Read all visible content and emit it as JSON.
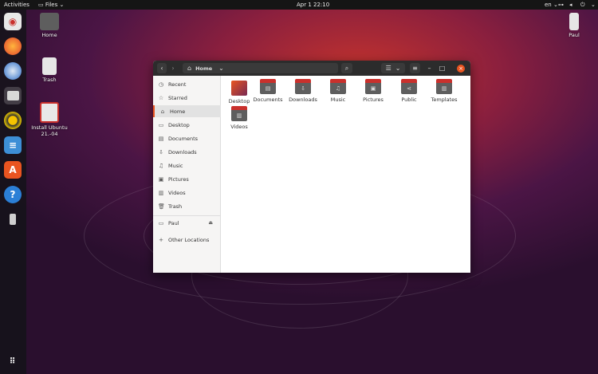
{
  "topbar": {
    "activities": "Activities",
    "app_menu": "Files",
    "clock": "Apr 1  22:10",
    "input_source": "en"
  },
  "desktop": {
    "home_label": "Home",
    "trash_label": "Trash",
    "installer_label": "Install Ubuntu 21.-04",
    "user_drive_label": "Paul"
  },
  "window": {
    "path_label": "Home",
    "sidebar": {
      "recent": "Recent",
      "starred": "Starred",
      "home": "Home",
      "desktop": "Desktop",
      "documents": "Documents",
      "downloads": "Downloads",
      "music": "Music",
      "pictures": "Pictures",
      "videos": "Videos",
      "trash": "Trash",
      "paul": "Paul",
      "other_locations": "Other Locations"
    },
    "files": {
      "desktop": "Desktop",
      "documents": "Documents",
      "downloads": "Downloads",
      "music": "Music",
      "pictures": "Pictures",
      "public": "Public",
      "templates": "Templates",
      "videos": "Videos"
    }
  },
  "colors": {
    "accent": "#e95420",
    "folder_tab": "#c9302c",
    "close_button": "#e95420"
  }
}
